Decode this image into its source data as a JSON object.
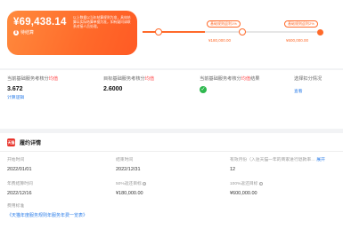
{
  "summary": {
    "amount": "¥69,438.14",
    "status": "待结算",
    "note": "以上数据以当年结算规则为准，具体结算以实际结算单据为准，如有疑问请联系对接人员处理。"
  },
  "progress": {
    "fill_fraction": 0.35,
    "milestones": [
      {
        "pill": "基础规则返利1%",
        "value": "¥180,000.00"
      },
      {
        "pill": "基础规则返利2%",
        "value": "¥600,000.00"
      }
    ]
  },
  "metrics": {
    "current": {
      "label_pre": "当前基础服务考核分",
      "label_hl": "均值",
      "value": "3.672",
      "link": "计算逻辑"
    },
    "target": {
      "label_pre": "目标基础服务考核分",
      "label_hl": "均值",
      "value": "2.6000"
    },
    "result": {
      "label_pre": "当前基础服务考核分",
      "label_hl": "均值",
      "label_post": "结果"
    },
    "choose": {
      "label": "选择扣分情况",
      "link": "查看"
    }
  },
  "details": {
    "title": "履约详情",
    "badge": "天猫",
    "start_label": "开始时间",
    "start_value": "2022/01/01",
    "end_label": "结束时间",
    "end_value": "2022/12/31",
    "months_label": "有效月份（入驻天猫一年的商家进行退款率…",
    "months_link": "展开",
    "months_value": "12",
    "settle_label": "年费结算时间",
    "settle_value": "2022/12/16",
    "half_label": "50%返还目标",
    "half_value": "¥180,000.00",
    "full_label": "100%返还目标",
    "full_value": "¥600,000.00",
    "doc_label": "费用标准",
    "doc_link": "《天猫年度服务规则年服务年费一览表》"
  }
}
